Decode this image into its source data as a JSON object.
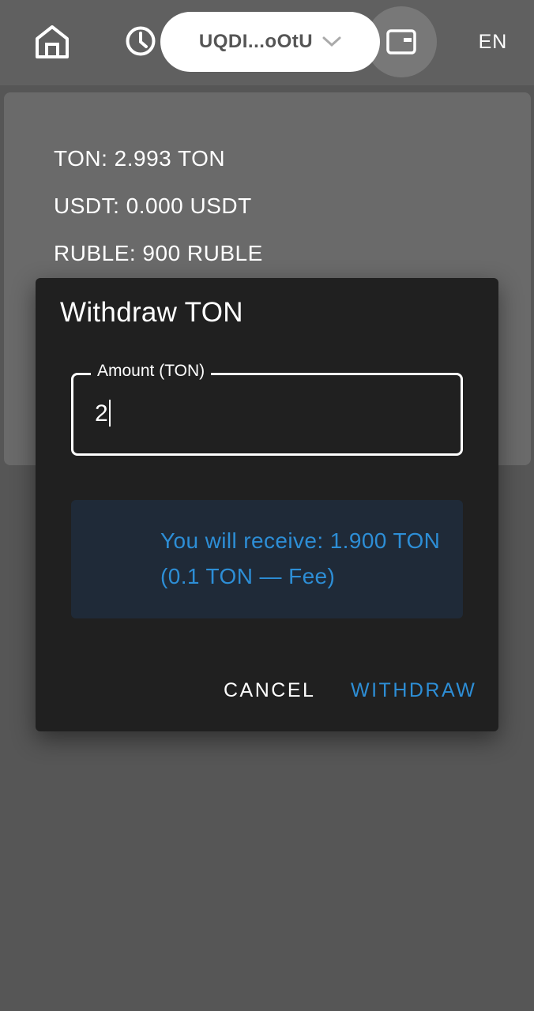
{
  "header": {
    "address": "UQDI...oOtU",
    "language": "EN",
    "icons": {
      "home": "home-icon",
      "history": "clock-icon",
      "address_dropdown": "chevron-down-icon",
      "wallet": "wallet-icon"
    }
  },
  "balances": [
    "TON: 2.993 TON",
    "USDT: 0.000 USDT",
    "RUBLE: 900 RUBLE"
  ],
  "dialog": {
    "title": "Withdraw TON",
    "amount_label": "Amount (TON)",
    "amount_value": "2",
    "receive_info": "You will receive: 1.900 TON (0.1 TON — Fee)",
    "cancel_label": "CANCEL",
    "withdraw_label": "WITHDRAW"
  },
  "colors": {
    "accent": "#2d8ed6",
    "dialog_bg": "#202020",
    "info_bg": "#1f2a38",
    "overlay_bg": "#565656"
  }
}
